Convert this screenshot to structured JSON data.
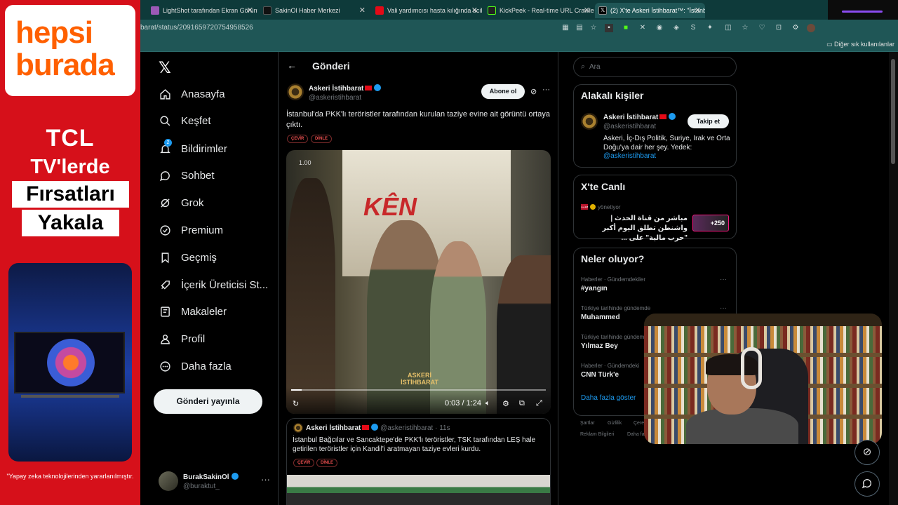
{
  "ad": {
    "brand": "hepsiburada",
    "brand_line1": "hepsi",
    "brand_line2": "burada",
    "tcl": "TCL",
    "tv": "TV'lerde",
    "firsat": "Fırsatları",
    "yakala": "Yakala",
    "fine_print": "\"Yapay zeka teknolojilerinden yararlanılmıştır."
  },
  "browser": {
    "tabs": [
      {
        "label": "LightShot tarafından Ekran Görünt",
        "icon": "feather-icon",
        "color": "#9b59b6"
      },
      {
        "label": "SakinOl Haber Merkezi",
        "icon": "tiktok-icon",
        "color": "#111111"
      },
      {
        "label": "Vali yardımcısı hasta kılığında acile",
        "icon": "news-icon",
        "color": "#e30a17"
      },
      {
        "label": "KickPeek - Real-time URL Crawler",
        "icon": "kick-icon",
        "color": "#53fc18"
      },
      {
        "label": "(2) X'te Askeri İstihbarat™: \"İstanbu",
        "icon": "x-icon",
        "color": "#000000"
      }
    ],
    "url": "barat/status/2091659720754958526",
    "bookmark_other": "Diğer sık kullanılanlar",
    "accent": "#1f5656"
  },
  "nav": {
    "items": [
      {
        "label": "Anasayfa",
        "icon": "home-icon"
      },
      {
        "label": "Keşfet",
        "icon": "search-icon"
      },
      {
        "label": "Bildirimler",
        "icon": "bell-icon",
        "badge": "2"
      },
      {
        "label": "Sohbet",
        "icon": "chat-icon"
      },
      {
        "label": "Grok",
        "icon": "grok-icon"
      },
      {
        "label": "Premium",
        "icon": "premium-icon"
      },
      {
        "label": "Geçmiş",
        "icon": "bookmark-icon"
      },
      {
        "label": "İçerik Üreticisi St...",
        "icon": "rocket-icon"
      },
      {
        "label": "Makaleler",
        "icon": "article-icon"
      },
      {
        "label": "Profil",
        "icon": "person-icon"
      },
      {
        "label": "Daha fazla",
        "icon": "more-circle-icon"
      }
    ],
    "post_button": "Gönderi yayınla",
    "me": {
      "name": "BurakSakinOl",
      "handle": "@buraktut_"
    }
  },
  "post": {
    "header": "Gönderi",
    "author_name": "Askeri İstihbarat",
    "author_handle": "@askeristihbarat",
    "follow": "Abone ol",
    "text": "İstanbul'da PKK'lı teröristler tarafından kurulan taziye evine ait görüntü ortaya çıktı.",
    "translate": "ÇEVİR",
    "listen": "DİNLE",
    "video": {
      "speed": "1.00",
      "time": "0:03 / 1:24",
      "progress": 0.04,
      "watermark_line1": "ASKERİ",
      "watermark_line2": "İSTİHBARAT",
      "wall_text": "KÊN"
    }
  },
  "reply": {
    "author_name": "Askeri İstihbarat",
    "author_handle": "@askeristihbarat",
    "time": "· 11s",
    "text": "İstanbul Bağcılar ve Sancaktepe'de PKK'lı teröristler, TSK tarafından LEŞ hale getirilen teröristler için Kandil'i aratmayan taziye evleri kurdu.",
    "translate": "ÇEVİR",
    "listen": "DİNLE"
  },
  "right": {
    "search_placeholder": "Ara",
    "related_title": "Alakalı kişiler",
    "related": {
      "name": "Askeri İstihbarat",
      "handle": "@askeristihbarat",
      "follow": "Takip et",
      "bio": "Askeri, İç-Dış Politik, Suriye, Irak ve Orta Doğu'ya dair her şey. Yedek:",
      "link": "@askeristihbarat"
    },
    "live_title": "X'te Canlı",
    "live": {
      "source_logo": "الحدث",
      "source_status": "yönetiyor",
      "text": "مباشر من قناة الحدث | واشنطن تطلق اليوم أكبر \"حرب مالية\" على ...",
      "viewers": "+250"
    },
    "trends_title": "Neler oluyor?",
    "trends": [
      {
        "meta": "Haberler · Gündemdekiler",
        "name": "#yangın"
      },
      {
        "meta": "Türkiye tarihinde gündemde",
        "name": "Muhammed"
      },
      {
        "meta": "Türkiye tarihinde gündemde",
        "name": "Yılmaz Bey"
      },
      {
        "meta": "Haberler · Gündemdeki",
        "name": "CNN Türk'e"
      }
    ],
    "show_more": "Daha fazla göster",
    "footer": [
      "Şartlar",
      "Gizlilik",
      "Çere",
      "Reklam Bilgileri",
      "Daha fazl"
    ]
  }
}
